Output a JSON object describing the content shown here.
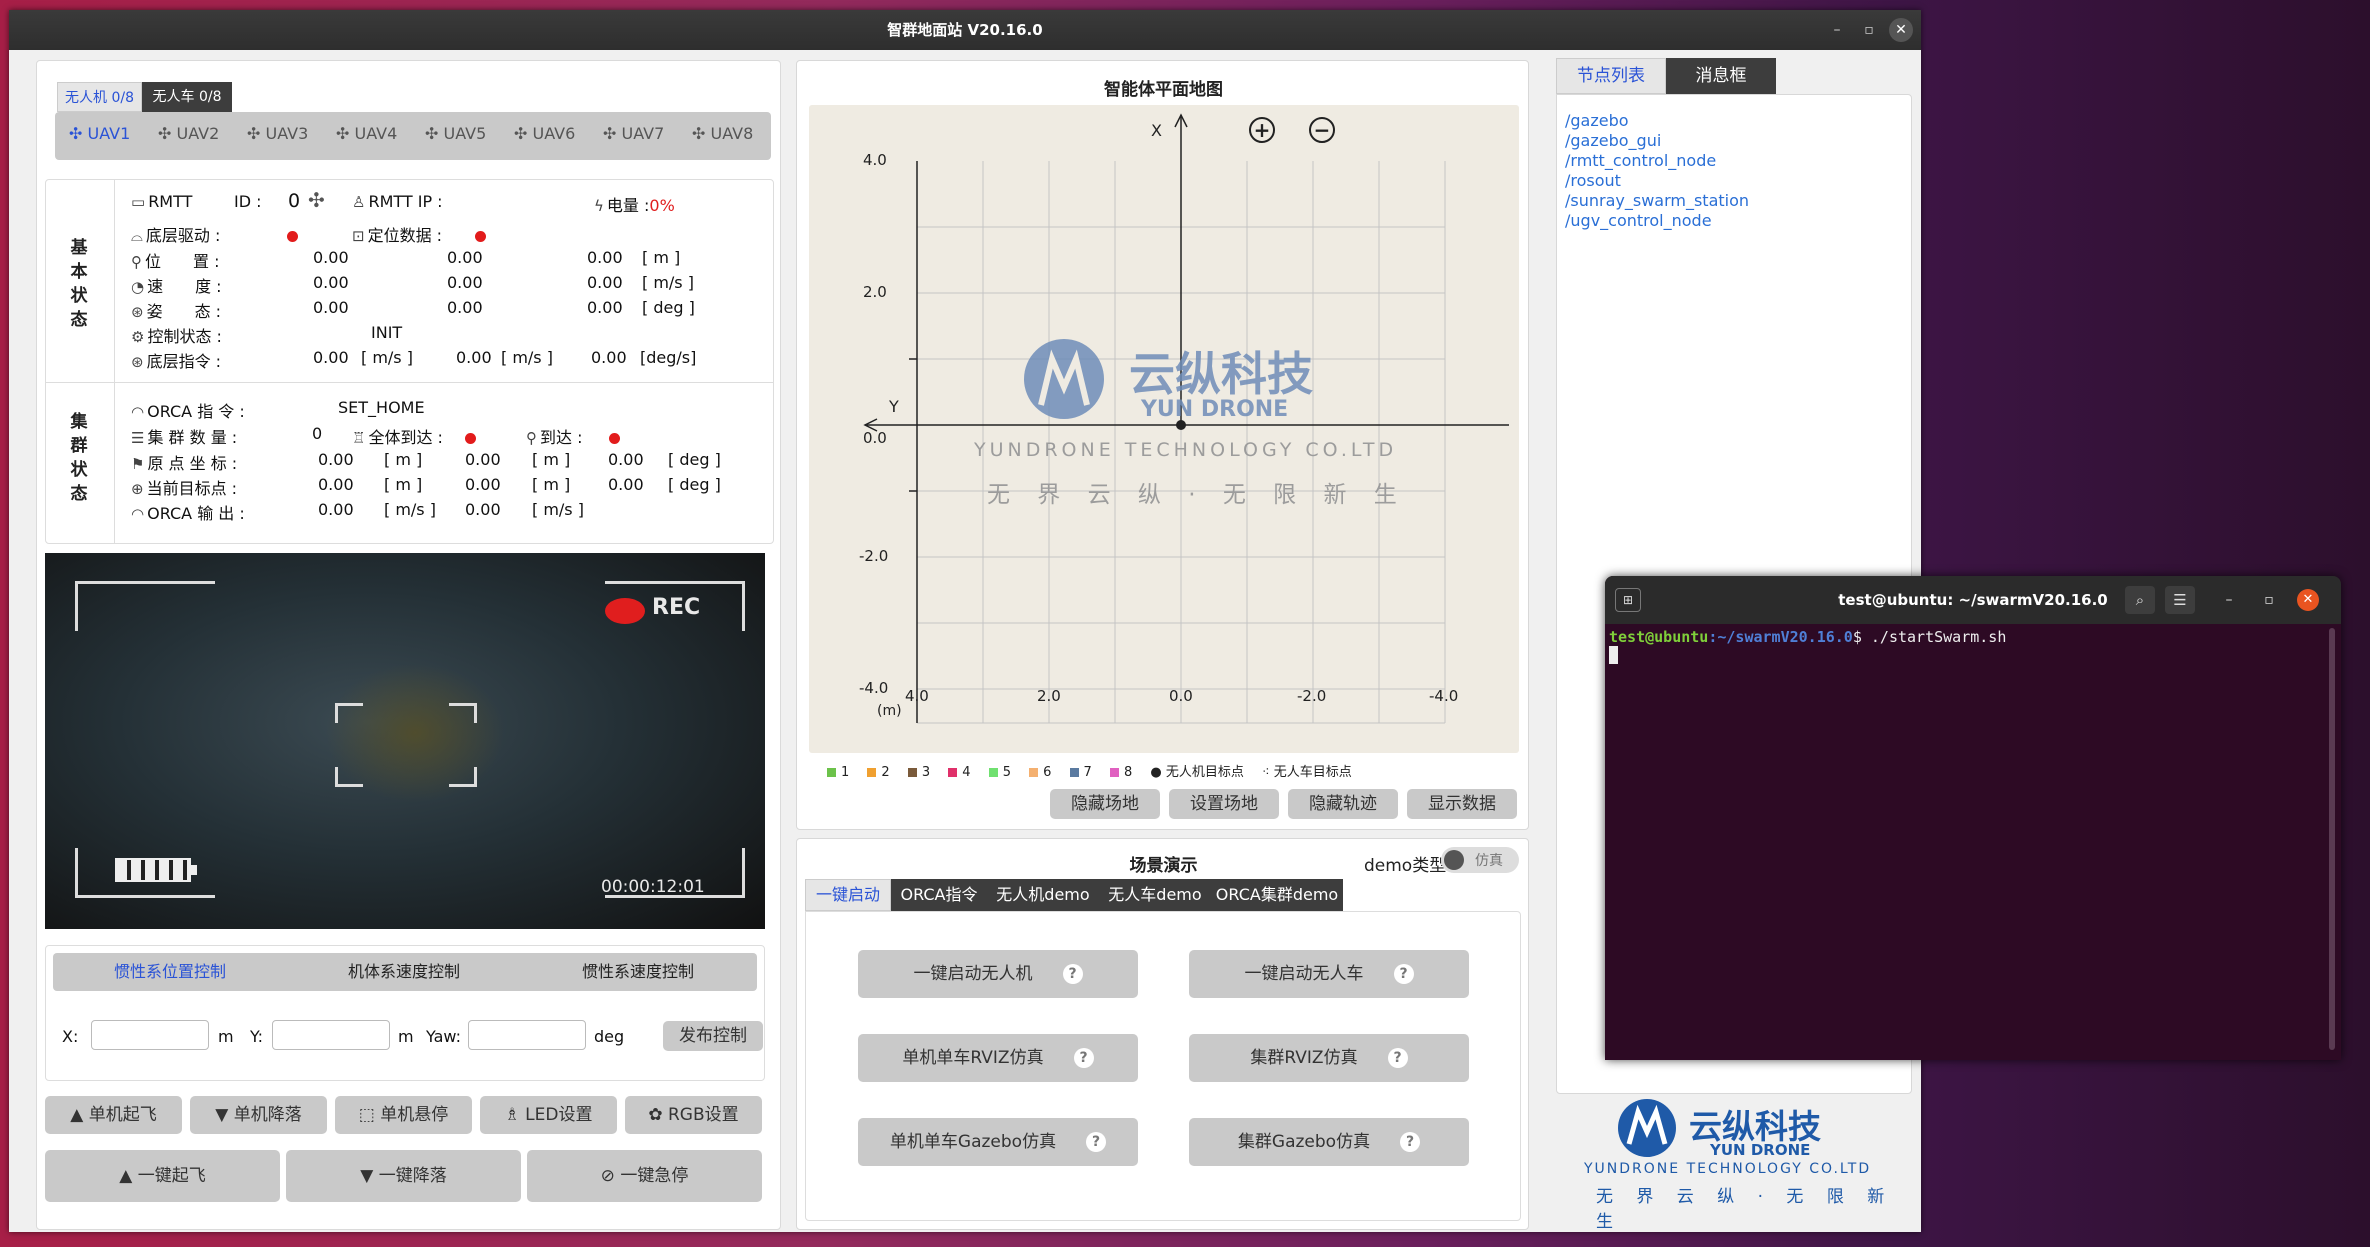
{
  "window": {
    "title": "智群地面站 V20.16.0",
    "min": "–",
    "max": "▫",
    "close": "✕"
  },
  "left": {
    "tabs": [
      "无人机 0/8",
      "无人车 0/8"
    ],
    "uavs": [
      "UAV1",
      "UAV2",
      "UAV3",
      "UAV4",
      "UAV5",
      "UAV6",
      "UAV7",
      "UAV8"
    ],
    "basic_side": "基本状态",
    "swarm_side": "集群状态",
    "rmtt_label": "RMTT",
    "id_label": "ID :",
    "id_value": "0",
    "ip_label": "RMTT IP :",
    "battery_label": "电量 :",
    "battery_value": "0%",
    "driver_label": "底层驱动 :",
    "loc_label": "定位数据 :",
    "pos_label": "位　　置 :",
    "vel_label": "速　　度 :",
    "att_label": "姿　　态 :",
    "ctrl_label": "控制状态 :",
    "cmd_label": "底层指令 :",
    "pos": [
      "0.00",
      "0.00",
      "0.00"
    ],
    "pos_unit": "[ m ]",
    "vel": [
      "0.00",
      "0.00",
      "0.00"
    ],
    "vel_unit": "[ m/s ]",
    "att": [
      "0.00",
      "0.00",
      "0.00"
    ],
    "att_unit": "[ deg ]",
    "ctrl_state": "INIT",
    "cmd": [
      "0.00",
      "[ m/s ]",
      "0.00",
      "[ m/s ]",
      "0.00",
      "[deg/s]"
    ],
    "orca_cmd_label": "ORCA 指 令 :",
    "orca_cmd": "SET_HOME",
    "swarm_num_label": "集 群 数 量 :",
    "swarm_num": "0",
    "all_arrive_label": "全体到达 :",
    "arrive_label": "到达 :",
    "origin_label": "原 点 坐 标 :",
    "origin": [
      "0.00",
      "[ m ]",
      "0.00",
      "[ m ]",
      "0.00",
      "[ deg ]"
    ],
    "target_label": "当前目标点 :",
    "target": [
      "0.00",
      "[ m ]",
      "0.00",
      "[ m ]",
      "0.00",
      "[ deg ]"
    ],
    "orca_out_label": "ORCA 输 出 :",
    "orca_out": [
      "0.00",
      "[ m/s ]",
      "0.00",
      "[ m/s ]"
    ],
    "video": {
      "rec": "REC",
      "time": "00:00:12:01"
    },
    "ctrl_tabs": [
      "惯性系位置控制",
      "机体系速度控制",
      "惯性系速度控制"
    ],
    "x_label": "X:",
    "y_label": "Y:",
    "yaw_label": "Yaw:",
    "m": "m",
    "deg": "deg",
    "publish": "发布控制",
    "btns1": [
      "单机起飞",
      "单机降落",
      "单机悬停",
      "LED设置",
      "RGB设置"
    ],
    "btns2": [
      "一键起飞",
      "一键降落",
      "一键急停"
    ]
  },
  "map": {
    "title": "智能体平面地图",
    "x_axis": "X",
    "y_axis": "Y",
    "unit": "(m)",
    "zoom_in": "+",
    "zoom_out": "−",
    "yticks": [
      "4.0",
      "2.0",
      "0.0",
      "-2.0",
      "-4.0"
    ],
    "xticks": [
      "4.0",
      "2.0",
      "0.0",
      "-2.0",
      "-4.0"
    ],
    "watermark": {
      "cn": "云纵科技",
      "en": "YUN DRONE",
      "co": "YUNDRONE TECHNOLOGY CO.LTD",
      "slogan": "无 界 云 纵 · 无 限 新 生"
    },
    "legend": [
      {
        "n": "1",
        "c": "#6cc24a"
      },
      {
        "n": "2",
        "c": "#f0a030"
      },
      {
        "n": "3",
        "c": "#7a5a3a"
      },
      {
        "n": "4",
        "c": "#e0306a"
      },
      {
        "n": "5",
        "c": "#70e070"
      },
      {
        "n": "6",
        "c": "#f4b070"
      },
      {
        "n": "7",
        "c": "#5a7aa0"
      },
      {
        "n": "8",
        "c": "#e060c0"
      }
    ],
    "legend_uav": "无人机目标点",
    "legend_ugv": "无人车目标点",
    "btns": [
      "隐藏场地",
      "设置场地",
      "隐藏轨迹",
      "显示数据"
    ]
  },
  "scene": {
    "title": "场景演示",
    "demo_type": "demo类型:",
    "toggle": "仿真",
    "tabs": [
      "一键启动",
      "ORCA指令",
      "无人机demo",
      "无人车demo",
      "ORCA集群demo"
    ],
    "btns": [
      "一键启动无人机",
      "一键启动无人车",
      "单机单车RVIZ仿真",
      "集群RVIZ仿真",
      "单机单车Gazebo仿真",
      "集群Gazebo仿真"
    ],
    "help": "?"
  },
  "right": {
    "tabs": [
      "节点列表",
      "消息框"
    ],
    "nodes": [
      "/gazebo",
      "/gazebo_gui",
      "/rmtt_control_node",
      "/rosout",
      "/sunray_swarm_station",
      "/ugv_control_node"
    ],
    "logo_cn": "云纵科技",
    "logo_en": "YUN DRONE",
    "logo_co": "YUNDRONE TECHNOLOGY CO.LTD",
    "logo_slogan": "无 界 云 纵 · 无 限 新 生"
  },
  "terminal": {
    "title": "test@ubuntu: ~/swarmV20.16.0",
    "user": "test@ubuntu",
    "path": ":~/swarmV20.16.0",
    "cmd": "$ ./startSwarm.sh"
  },
  "colors": {
    "accent": "#2a53d6",
    "red": "#e01e1e",
    "terminal_bg": "#2d0a24",
    "logo_blue": "#1f5aa8"
  }
}
